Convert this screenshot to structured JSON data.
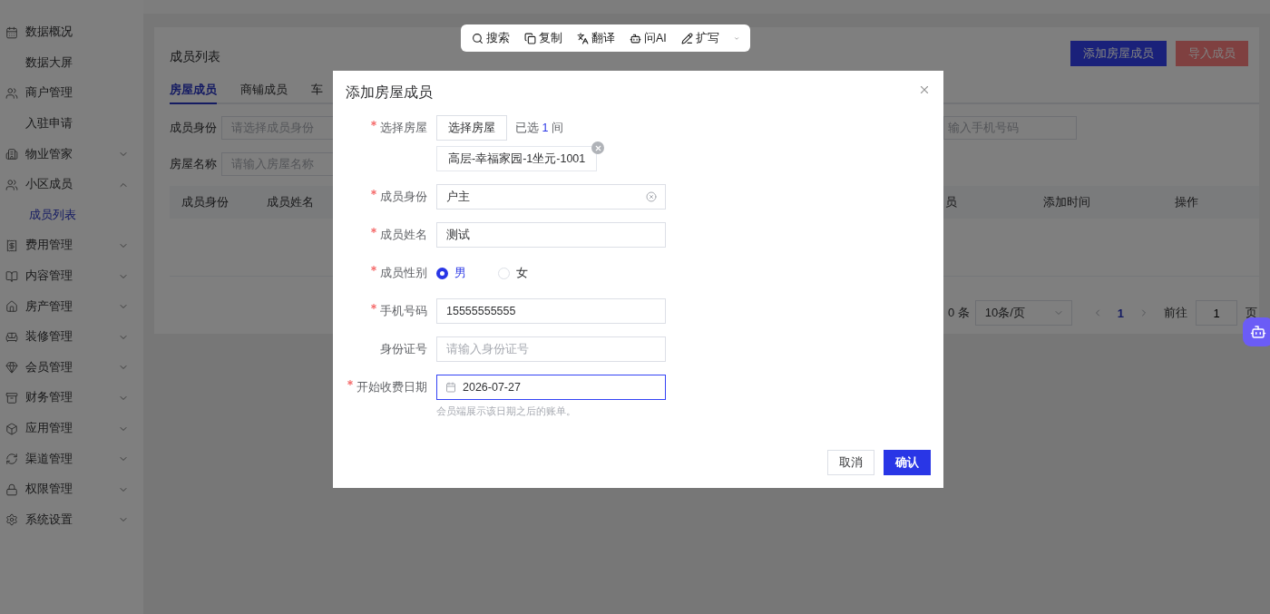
{
  "sidebar": {
    "items": [
      {
        "label": "数据概况",
        "children": [
          {
            "label": "数据大屏",
            "selected": false
          }
        ]
      },
      {
        "label": "商户管理",
        "children": [
          {
            "label": "入驻申请",
            "selected": false
          }
        ]
      },
      {
        "label": "物业管家",
        "expanded": false
      },
      {
        "label": "小区成员",
        "expanded": true,
        "children": [
          {
            "label": "成员列表",
            "selected": true
          }
        ]
      },
      {
        "label": "费用管理",
        "expanded": false
      },
      {
        "label": "内容管理",
        "expanded": false
      },
      {
        "label": "房产管理",
        "expanded": false
      },
      {
        "label": "装修管理",
        "expanded": false
      },
      {
        "label": "会员管理",
        "expanded": false
      },
      {
        "label": "财务管理",
        "expanded": false
      },
      {
        "label": "应用管理",
        "expanded": false
      },
      {
        "label": "渠道管理",
        "expanded": false
      },
      {
        "label": "权限管理",
        "expanded": false
      },
      {
        "label": "系统设置",
        "expanded": false
      }
    ]
  },
  "page": {
    "title": "成员列表",
    "actions": [
      {
        "label": "添加房屋成员",
        "kind": "primary"
      },
      {
        "label": "导入成员",
        "kind": "danger"
      }
    ],
    "tabs": [
      {
        "label": "房屋成员",
        "selected": true
      },
      {
        "label": "商铺成员",
        "selected": false
      },
      {
        "label": "车",
        "selected": false
      }
    ],
    "filters": [
      {
        "label": "成员身份",
        "placeholder": "请选择成员身份"
      },
      {
        "label": "房屋名称",
        "placeholder": "请输入房屋名称"
      }
    ],
    "filter_right": {
      "placeholder": "输入手机号码"
    },
    "table": {
      "columns_left": [
        "成员身份",
        "成员姓名"
      ],
      "columns_right": [
        "员",
        "添加时间",
        "操作"
      ]
    },
    "pagination": {
      "total": "0 条",
      "page_size": "10条/页",
      "pages": [
        {
          "label": "1",
          "selected": true
        }
      ],
      "jump_label": "前往",
      "jump_value": "1",
      "jump_suffix": "页"
    }
  },
  "toolbar": {
    "items": [
      {
        "label": "搜索"
      },
      {
        "label": "复制"
      },
      {
        "label": "翻译"
      },
      {
        "label": "问AI"
      },
      {
        "label": "扩写"
      }
    ]
  },
  "dialog": {
    "title": "添加房屋成员",
    "fields": [
      {
        "kind": "house",
        "label": "选择房屋",
        "required": true,
        "button": "选择房屋",
        "count_prefix": "已选",
        "count": "1",
        "count_suffix": "间",
        "chips": [
          "高层-幸福家园-1坐元-1001"
        ]
      },
      {
        "kind": "select",
        "label": "成员身份",
        "required": true,
        "value": "户主"
      },
      {
        "kind": "text",
        "label": "成员姓名",
        "required": true,
        "value": "测试"
      },
      {
        "kind": "radio",
        "label": "成员性别",
        "required": true,
        "options": [
          {
            "label": "男",
            "selected": true
          },
          {
            "label": "女",
            "selected": false
          }
        ]
      },
      {
        "kind": "text",
        "label": "手机号码",
        "required": true,
        "value": "15555555555"
      },
      {
        "kind": "text",
        "label": "身份证号",
        "required": false,
        "placeholder": "请输入身份证号"
      },
      {
        "kind": "date",
        "label": "开始收费日期",
        "required": true,
        "value": "2026-07-27",
        "focused": true,
        "hint": "会员端展示该日期之后的账单。"
      }
    ],
    "buttons": [
      {
        "label": "取消",
        "kind": "default"
      },
      {
        "label": "确认",
        "kind": "primary"
      }
    ]
  }
}
